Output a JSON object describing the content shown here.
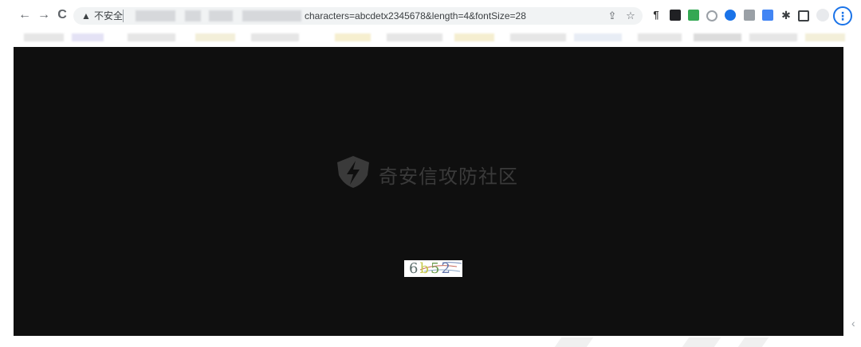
{
  "toolbar": {
    "back_glyph": "←",
    "forward_glyph": "→",
    "reload_glyph": "C",
    "security_label": "不安全",
    "url_visible": "characters=abcdetx2345678&length=4&fontSize=28"
  },
  "page": {
    "watermark_text": "奇安信攻防社区",
    "captcha_text": [
      "6",
      "b",
      "5",
      "2"
    ]
  },
  "icons": {
    "warning": "warning-icon",
    "share": "share-icon",
    "star": "star-icon",
    "menu_glyph": "⋮"
  },
  "colors": {
    "page_bg": "#0f0f0f",
    "menu_accent": "#1a73e8"
  }
}
